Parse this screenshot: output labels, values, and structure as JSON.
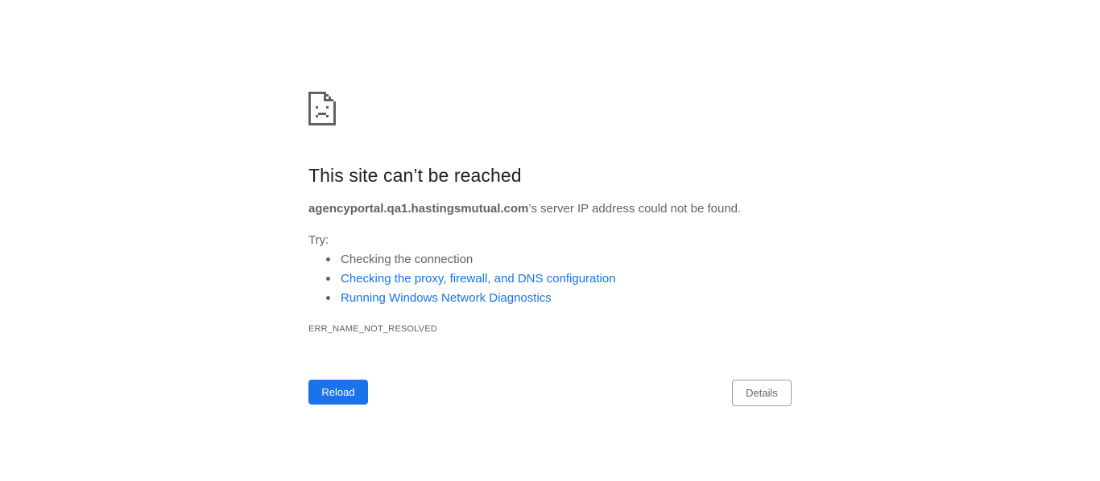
{
  "icon": "sad-page-icon",
  "title": "This site can’t be reached",
  "summary": {
    "host": "agencyportal.qa1.hastingsmutual.com",
    "message": "’s server IP address could not be found."
  },
  "try_label": "Try:",
  "suggestions": [
    {
      "text": "Checking the connection",
      "is_link": false
    },
    {
      "text": "Checking the proxy, firewall, and DNS configuration",
      "is_link": true
    },
    {
      "text": "Running Windows Network Diagnostics",
      "is_link": true
    }
  ],
  "error_code": "ERR_NAME_NOT_RESOLVED",
  "buttons": {
    "reload_label": "Reload",
    "details_label": "Details"
  },
  "colors": {
    "link": "#1a73e8",
    "primary_button": "#1a73e8",
    "text": "#5f6368",
    "heading": "#202124"
  }
}
